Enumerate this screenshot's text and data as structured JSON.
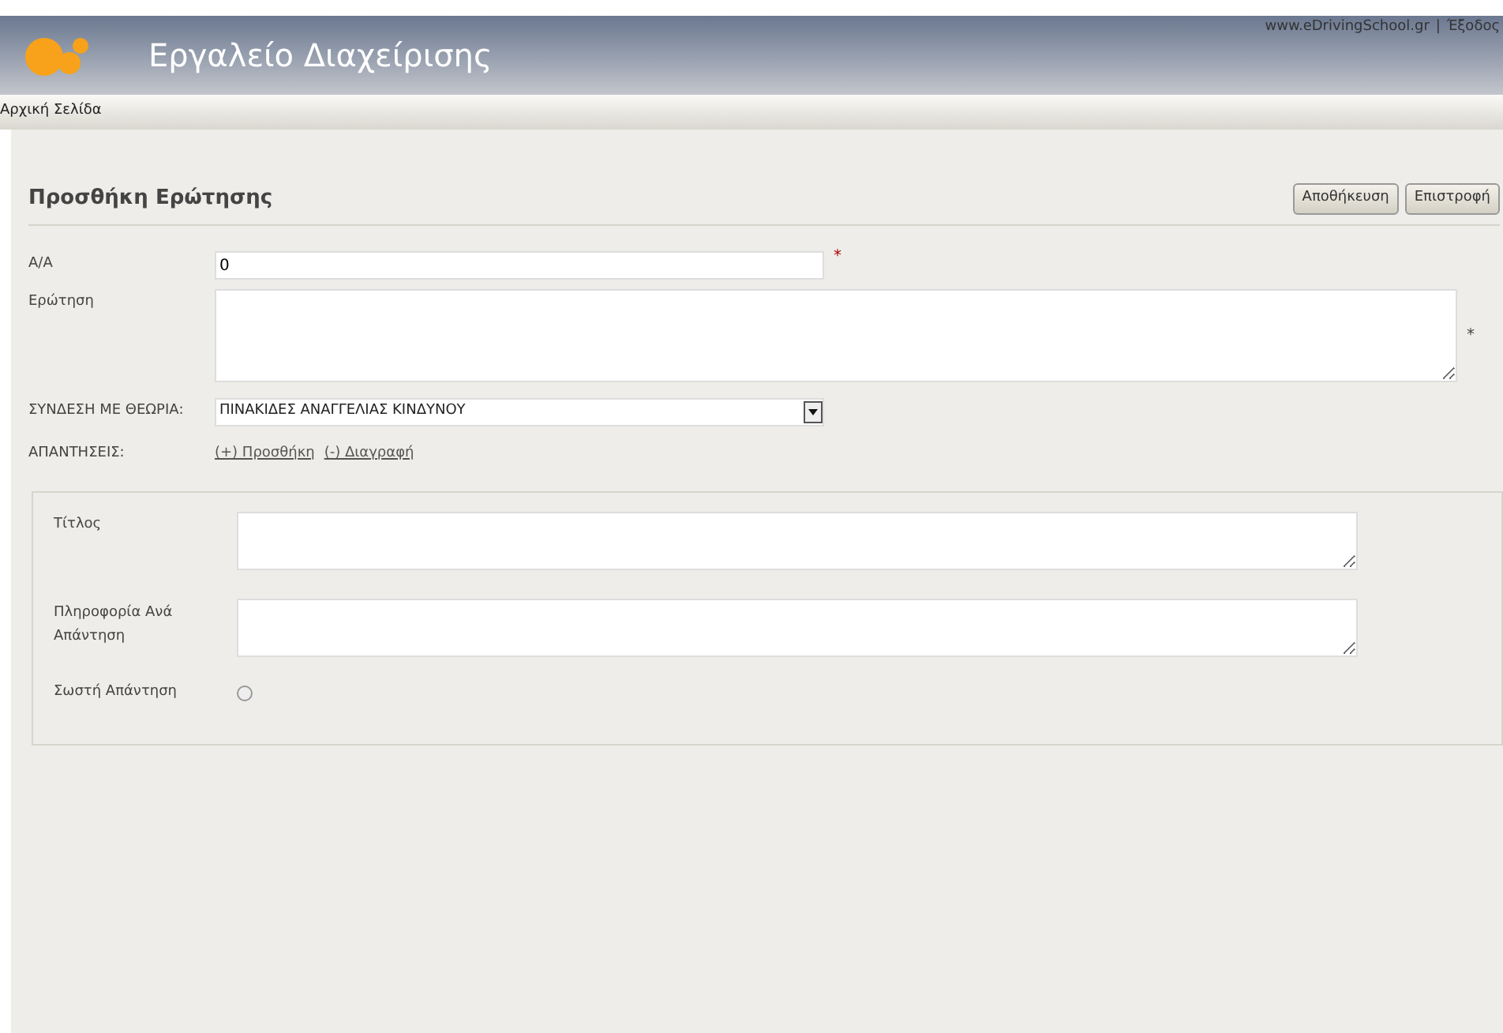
{
  "header": {
    "title": "Εργαλείο Διαχείρισης",
    "links": [
      "www.eDrivingSchool.gr",
      "Έξοδος"
    ],
    "separator": "|"
  },
  "breadcrumb": "Αρχική Σελίδα",
  "page": {
    "title": "Προσθήκη Ερώτησης",
    "buttons": [
      "Αποθήκευση",
      "Επιστροφή"
    ]
  },
  "form": {
    "number": {
      "label": "Α/Α",
      "value": "0",
      "required_mark": "*"
    },
    "question": {
      "label": "Ερώτηση",
      "required_mark": "*"
    },
    "theory": {
      "label": "ΣΥΝΔΕΣΗ ΜΕ ΘΕΩΡΙΑ:",
      "value": "ΠΙΝΑΚΙΔΕΣ ΑΝΑΓΓΕΛΙΑΣ ΚΙΝΔΥΝΟΥ"
    },
    "answers": {
      "label": "ΑΠΑΝΤΗΣΕΙΣ:",
      "actions": [
        "(+) Προσθήκη",
        "(-) Διαγραφή"
      ]
    }
  },
  "answer": {
    "title_label": "Τίτλος",
    "info_label": "Πληροφορία Ανά Απάντηση",
    "correct_label": "Σωστή Απάντηση",
    "correct": false
  }
}
